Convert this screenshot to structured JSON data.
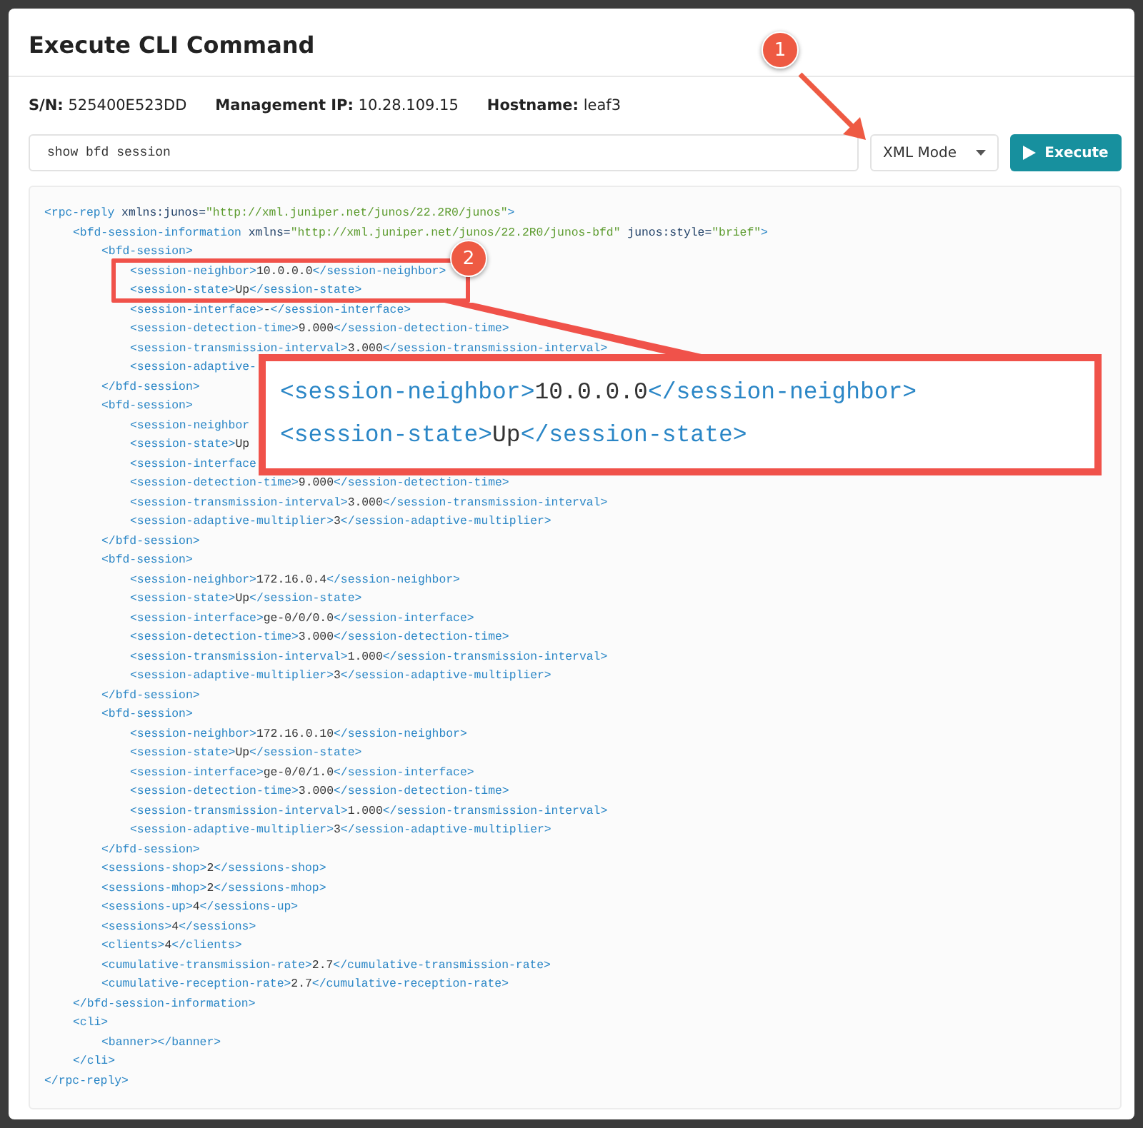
{
  "dialog": {
    "title": "Execute CLI Command"
  },
  "device_info": [
    "**S/N:** 525400E523DD",
    "**Management IP:** 10.28.109.15",
    "**Hostname:** leaf3"
  ],
  "command": {
    "value": "show bfd session"
  },
  "mode_select": {
    "value": "XML Mode"
  },
  "execute_button": {
    "label": "Execute"
  },
  "output": {
    "lines": [
      {
        "parts": [
          {
            "kind": "tag",
            "text": "<rpc-reply"
          },
          {
            "kind": "attr",
            "text": " xmlns:junos="
          },
          {
            "kind": "str",
            "text": "\"http://xml.juniper.net/junos/22.2R0/junos\""
          },
          {
            "kind": "tag",
            "text": ">"
          }
        ],
        "children": [
          {
            "parts": [
              {
                "kind": "tag",
                "text": "<bfd-session-information"
              },
              {
                "kind": "attr",
                "text": " xmlns="
              },
              {
                "kind": "str",
                "text": "\"http://xml.juniper.net/junos/22.2R0/junos-bfd\""
              },
              {
                "kind": "attr",
                "text": " junos:style="
              },
              {
                "kind": "str",
                "text": "\"brief\""
              },
              {
                "kind": "tag",
                "text": ">"
              }
            ],
            "children": [
              {
                "parts": [
                  {
                    "kind": "tag",
                    "text": "<bfd-session>"
                  }
                ],
                "children": [
                  {
                    "parts": [
                      {
                        "kind": "tag",
                        "text": "<session-neighbor>"
                      },
                      {
                        "kind": "text",
                        "text": "10.0.0.0"
                      },
                      {
                        "kind": "tag",
                        "text": "</session-neighbor>"
                      }
                    ]
                  },
                  {
                    "parts": [
                      {
                        "kind": "tag",
                        "text": "<session-state>"
                      },
                      {
                        "kind": "text",
                        "text": "Up"
                      },
                      {
                        "kind": "tag",
                        "text": "</session-state>"
                      }
                    ]
                  },
                  {
                    "parts": [
                      {
                        "kind": "tag",
                        "text": "<session-interface>"
                      },
                      {
                        "kind": "text",
                        "text": "-"
                      },
                      {
                        "kind": "tag",
                        "text": "</session-interface>"
                      }
                    ]
                  },
                  {
                    "parts": [
                      {
                        "kind": "tag",
                        "text": "<session-detection-time>"
                      },
                      {
                        "kind": "text",
                        "text": "9.000"
                      },
                      {
                        "kind": "tag",
                        "text": "</session-detection-time>"
                      }
                    ]
                  },
                  {
                    "parts": [
                      {
                        "kind": "tag",
                        "text": "<session-transmission-interval>"
                      },
                      {
                        "kind": "text",
                        "text": "3.000"
                      },
                      {
                        "kind": "tag",
                        "text": "</session-transmission-interval>"
                      }
                    ]
                  },
                  {
                    "parts": [
                      {
                        "kind": "tag",
                        "text": "<session-adaptive-"
                      }
                    ]
                  }
                ]
              },
              {
                "parts": [
                  {
                    "kind": "tag",
                    "text": "</bfd-session>"
                  }
                ]
              },
              {
                "parts": [
                  {
                    "kind": "tag",
                    "text": "<bfd-session>"
                  }
                ],
                "children": [
                  {
                    "parts": [
                      {
                        "kind": "tag",
                        "text": "<session-neighbor"
                      }
                    ]
                  },
                  {
                    "parts": [
                      {
                        "kind": "tag",
                        "text": "<session-state>"
                      },
                      {
                        "kind": "text",
                        "text": "Up"
                      }
                    ]
                  },
                  {
                    "parts": [
                      {
                        "kind": "tag",
                        "text": "<session-interface"
                      }
                    ]
                  },
                  {
                    "parts": [
                      {
                        "kind": "tag",
                        "text": "<session-detection-time>"
                      },
                      {
                        "kind": "text",
                        "text": "9.000"
                      },
                      {
                        "kind": "tag",
                        "text": "</session-detection-time>"
                      }
                    ]
                  },
                  {
                    "parts": [
                      {
                        "kind": "tag",
                        "text": "<session-transmission-interval>"
                      },
                      {
                        "kind": "text",
                        "text": "3.000"
                      },
                      {
                        "kind": "tag",
                        "text": "</session-transmission-interval>"
                      }
                    ]
                  },
                  {
                    "parts": [
                      {
                        "kind": "tag",
                        "text": "<session-adaptive-multiplier>"
                      },
                      {
                        "kind": "text",
                        "text": "3"
                      },
                      {
                        "kind": "tag",
                        "text": "</session-adaptive-multiplier>"
                      }
                    ]
                  }
                ]
              },
              {
                "parts": [
                  {
                    "kind": "tag",
                    "text": "</bfd-session>"
                  }
                ]
              },
              {
                "parts": [
                  {
                    "kind": "tag",
                    "text": "<bfd-session>"
                  }
                ],
                "children": [
                  {
                    "parts": [
                      {
                        "kind": "tag",
                        "text": "<session-neighbor>"
                      },
                      {
                        "kind": "text",
                        "text": "172.16.0.4"
                      },
                      {
                        "kind": "tag",
                        "text": "</session-neighbor>"
                      }
                    ]
                  },
                  {
                    "parts": [
                      {
                        "kind": "tag",
                        "text": "<session-state>"
                      },
                      {
                        "kind": "text",
                        "text": "Up"
                      },
                      {
                        "kind": "tag",
                        "text": "</session-state>"
                      }
                    ]
                  },
                  {
                    "parts": [
                      {
                        "kind": "tag",
                        "text": "<session-interface>"
                      },
                      {
                        "kind": "text",
                        "text": "ge-0/0/0.0"
                      },
                      {
                        "kind": "tag",
                        "text": "</session-interface>"
                      }
                    ]
                  },
                  {
                    "parts": [
                      {
                        "kind": "tag",
                        "text": "<session-detection-time>"
                      },
                      {
                        "kind": "text",
                        "text": "3.000"
                      },
                      {
                        "kind": "tag",
                        "text": "</session-detection-time>"
                      }
                    ]
                  },
                  {
                    "parts": [
                      {
                        "kind": "tag",
                        "text": "<session-transmission-interval>"
                      },
                      {
                        "kind": "text",
                        "text": "1.000"
                      },
                      {
                        "kind": "tag",
                        "text": "</session-transmission-interval>"
                      }
                    ]
                  },
                  {
                    "parts": [
                      {
                        "kind": "tag",
                        "text": "<session-adaptive-multiplier>"
                      },
                      {
                        "kind": "text",
                        "text": "3"
                      },
                      {
                        "kind": "tag",
                        "text": "</session-adaptive-multiplier>"
                      }
                    ]
                  }
                ]
              },
              {
                "parts": [
                  {
                    "kind": "tag",
                    "text": "</bfd-session>"
                  }
                ]
              },
              {
                "parts": [
                  {
                    "kind": "tag",
                    "text": "<bfd-session>"
                  }
                ],
                "children": [
                  {
                    "parts": [
                      {
                        "kind": "tag",
                        "text": "<session-neighbor>"
                      },
                      {
                        "kind": "text",
                        "text": "172.16.0.10"
                      },
                      {
                        "kind": "tag",
                        "text": "</session-neighbor>"
                      }
                    ]
                  },
                  {
                    "parts": [
                      {
                        "kind": "tag",
                        "text": "<session-state>"
                      },
                      {
                        "kind": "text",
                        "text": "Up"
                      },
                      {
                        "kind": "tag",
                        "text": "</session-state>"
                      }
                    ]
                  },
                  {
                    "parts": [
                      {
                        "kind": "tag",
                        "text": "<session-interface>"
                      },
                      {
                        "kind": "text",
                        "text": "ge-0/0/1.0"
                      },
                      {
                        "kind": "tag",
                        "text": "</session-interface>"
                      }
                    ]
                  },
                  {
                    "parts": [
                      {
                        "kind": "tag",
                        "text": "<session-detection-time>"
                      },
                      {
                        "kind": "text",
                        "text": "3.000"
                      },
                      {
                        "kind": "tag",
                        "text": "</session-detection-time>"
                      }
                    ]
                  },
                  {
                    "parts": [
                      {
                        "kind": "tag",
                        "text": "<session-transmission-interval>"
                      },
                      {
                        "kind": "text",
                        "text": "1.000"
                      },
                      {
                        "kind": "tag",
                        "text": "</session-transmission-interval>"
                      }
                    ]
                  },
                  {
                    "parts": [
                      {
                        "kind": "tag",
                        "text": "<session-adaptive-multiplier>"
                      },
                      {
                        "kind": "text",
                        "text": "3"
                      },
                      {
                        "kind": "tag",
                        "text": "</session-adaptive-multiplier>"
                      }
                    ]
                  }
                ]
              },
              {
                "parts": [
                  {
                    "kind": "tag",
                    "text": "</bfd-session>"
                  }
                ]
              },
              {
                "parts": [
                  {
                    "kind": "tag",
                    "text": "<sessions-shop>"
                  },
                  {
                    "kind": "text",
                    "text": "2"
                  },
                  {
                    "kind": "tag",
                    "text": "</sessions-shop>"
                  }
                ]
              },
              {
                "parts": [
                  {
                    "kind": "tag",
                    "text": "<sessions-mhop>"
                  },
                  {
                    "kind": "text",
                    "text": "2"
                  },
                  {
                    "kind": "tag",
                    "text": "</sessions-mhop>"
                  }
                ]
              },
              {
                "parts": [
                  {
                    "kind": "tag",
                    "text": "<sessions-up>"
                  },
                  {
                    "kind": "text",
                    "text": "4"
                  },
                  {
                    "kind": "tag",
                    "text": "</sessions-up>"
                  }
                ]
              },
              {
                "parts": [
                  {
                    "kind": "tag",
                    "text": "<sessions>"
                  },
                  {
                    "kind": "text",
                    "text": "4"
                  },
                  {
                    "kind": "tag",
                    "text": "</sessions>"
                  }
                ]
              },
              {
                "parts": [
                  {
                    "kind": "tag",
                    "text": "<clients>"
                  },
                  {
                    "kind": "text",
                    "text": "4"
                  },
                  {
                    "kind": "tag",
                    "text": "</clients>"
                  }
                ]
              },
              {
                "parts": [
                  {
                    "kind": "tag",
                    "text": "<cumulative-transmission-rate>"
                  },
                  {
                    "kind": "text",
                    "text": "2.7"
                  },
                  {
                    "kind": "tag",
                    "text": "</cumulative-transmission-rate>"
                  }
                ]
              },
              {
                "parts": [
                  {
                    "kind": "tag",
                    "text": "<cumulative-reception-rate>"
                  },
                  {
                    "kind": "text",
                    "text": "2.7"
                  },
                  {
                    "kind": "tag",
                    "text": "</cumulative-reception-rate>"
                  }
                ]
              }
            ]
          },
          {
            "parts": [
              {
                "kind": "tag",
                "text": "</bfd-session-information>"
              }
            ]
          },
          {
            "parts": [
              {
                "kind": "tag",
                "text": "<cli>"
              }
            ],
            "children": [
              {
                "parts": [
                  {
                    "kind": "tag",
                    "text": "<banner></banner>"
                  }
                ]
              }
            ]
          },
          {
            "parts": [
              {
                "kind": "tag",
                "text": "</cli>"
              }
            ]
          }
        ]
      },
      {
        "parts": [
          {
            "kind": "tag",
            "text": "</rpc-reply>"
          }
        ]
      }
    ]
  },
  "annotations": {
    "badges": [
      "1",
      "2"
    ],
    "zoom_callout": {
      "lines": [
        [
          {
            "kind": "tag",
            "text": "<session-neighbor>"
          },
          {
            "kind": "text",
            "text": "10.0.0.0"
          },
          {
            "kind": "tag",
            "text": "</session-neighbor>"
          }
        ],
        [
          {
            "kind": "tag",
            "text": "<session-state>"
          },
          {
            "kind": "text",
            "text": "Up"
          },
          {
            "kind": "tag",
            "text": "</session-state>"
          }
        ]
      ]
    }
  }
}
